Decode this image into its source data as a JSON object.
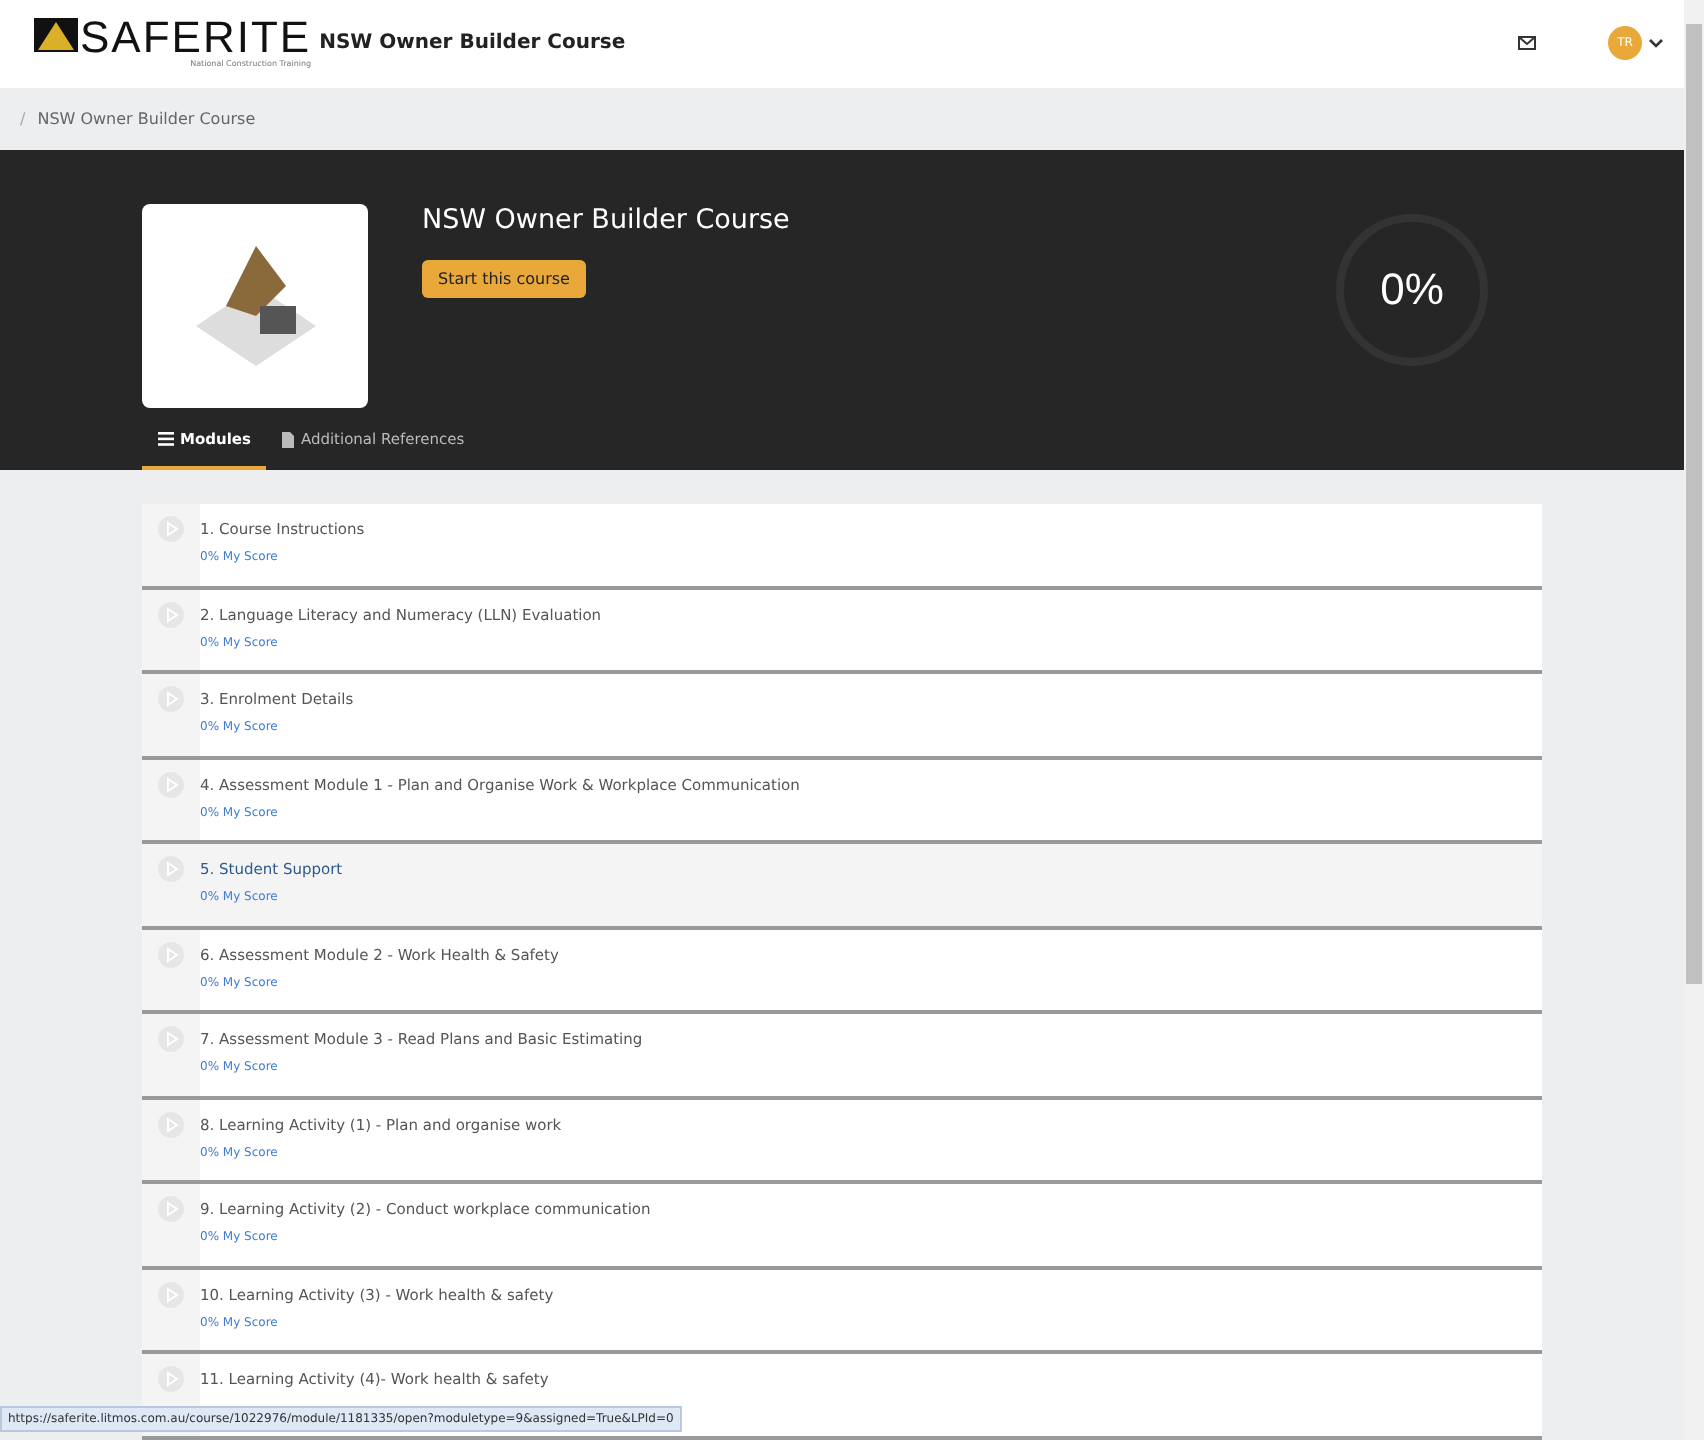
{
  "header": {
    "logo_text": "SAFERITE",
    "logo_tagline": "National Construction Training",
    "title": "NSW Owner Builder Course",
    "avatar_initials": "TR"
  },
  "breadcrumb": {
    "separator": "/",
    "label": "NSW Owner Builder Course"
  },
  "hero": {
    "title": "NSW Owner Builder Course",
    "start_button": "Start this course",
    "progress_text": "0%",
    "level": 0
  },
  "tabs": [
    {
      "label": "Modules",
      "kind": "list",
      "selected": true
    },
    {
      "label": "Additional References",
      "kind": "file",
      "selected": false
    }
  ],
  "modules": [
    {
      "title": "1. Course Instructions",
      "score": "0% My Score",
      "hovered": false
    },
    {
      "title": "2. Language Literacy and Numeracy (LLN) Evaluation",
      "score": "0% My Score",
      "hovered": false
    },
    {
      "title": "3. Enrolment Details",
      "score": "0% My Score",
      "hovered": false
    },
    {
      "title": "4. Assessment Module 1 - Plan and Organise Work & Workplace Communication",
      "score": "0% My Score",
      "hovered": false
    },
    {
      "title": "5. Student Support",
      "score": "0% My Score",
      "hovered": true
    },
    {
      "title": "6. Assessment Module 2 - Work Health & Safety",
      "score": "0% My Score",
      "hovered": false
    },
    {
      "title": "7. Assessment Module 3 - Read Plans and Basic Estimating",
      "score": "0% My Score",
      "hovered": false
    },
    {
      "title": "8. Learning Activity (1) - Plan and organise work",
      "score": "0% My Score",
      "hovered": false
    },
    {
      "title": "9. Learning Activity (2) - Conduct workplace communication",
      "score": "0% My Score",
      "hovered": false
    },
    {
      "title": "10. Learning Activity (3) - Work health & safety",
      "score": "0% My Score",
      "hovered": false
    },
    {
      "title": "11. Learning Activity (4)- Work health & safety",
      "hovered": false
    }
  ],
  "status_url": "https://saferite.litmos.com.au/course/1022976/module/1181335/open?moduletype=9&assigned=True&LPId=0"
}
